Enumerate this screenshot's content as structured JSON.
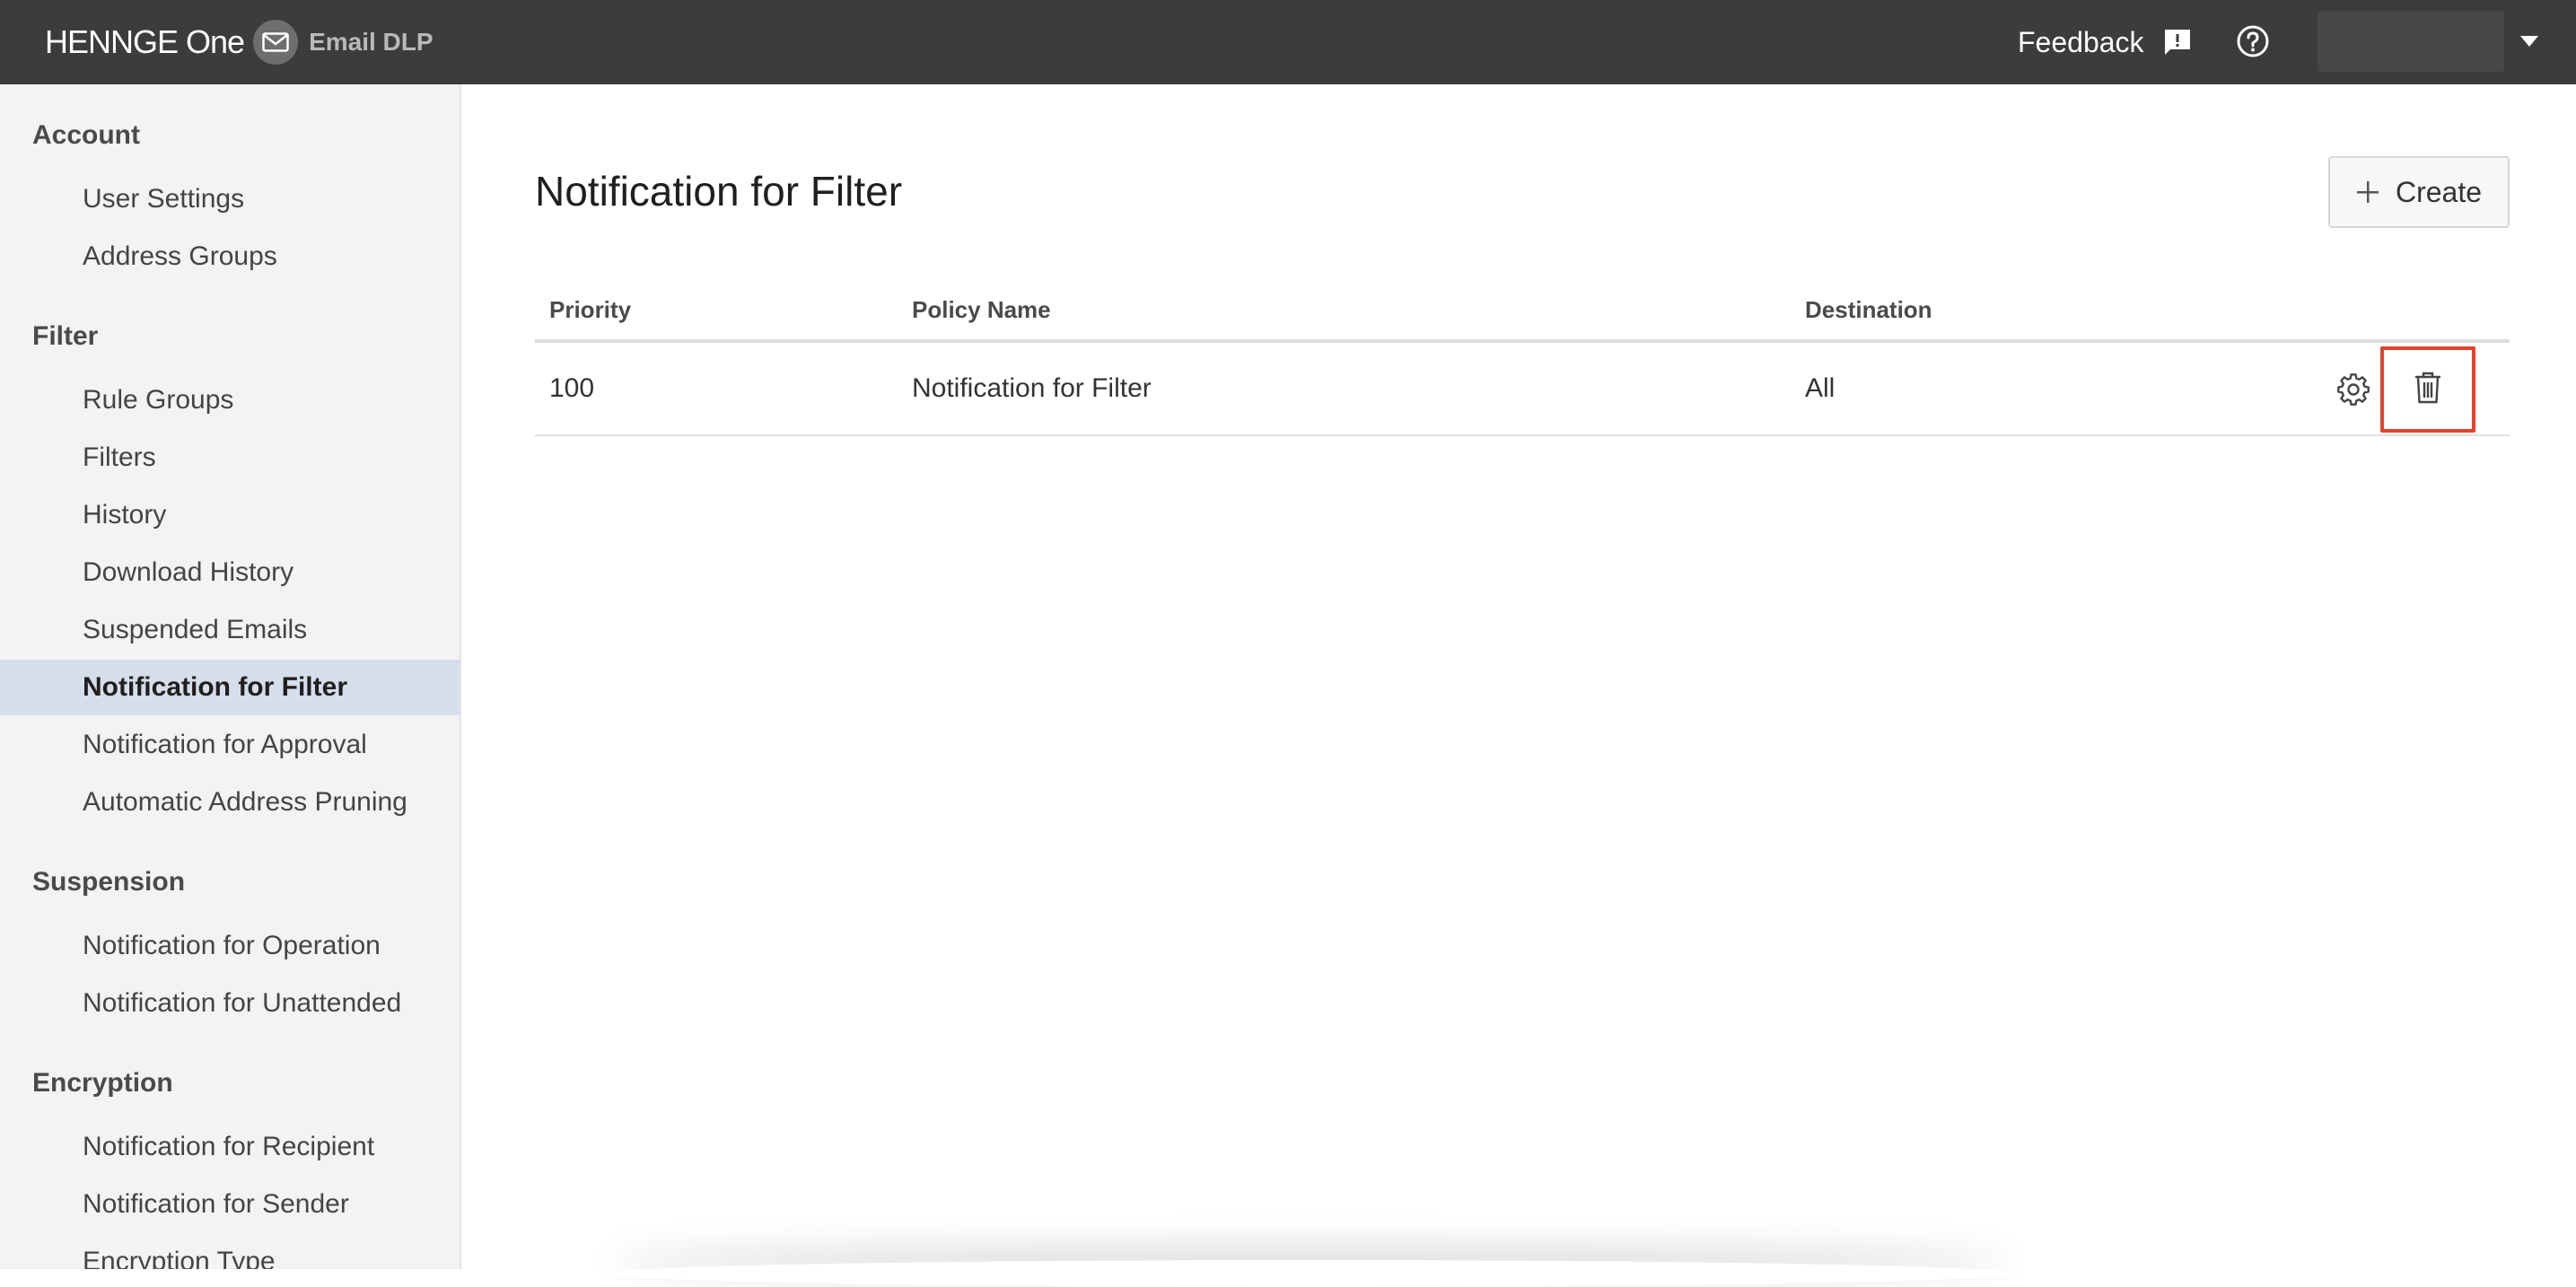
{
  "header": {
    "brand_name": "HENNGE One",
    "product_name": "Email DLP",
    "feedback_label": "Feedback",
    "user_name": ""
  },
  "sidebar": {
    "sections": [
      {
        "title": "Account",
        "items": [
          "User Settings",
          "Address Groups"
        ]
      },
      {
        "title": "Filter",
        "items": [
          "Rule Groups",
          "Filters",
          "History",
          "Download History",
          "Suspended Emails",
          "Notification for Filter",
          "Notification for Approval",
          "Automatic Address Pruning"
        ]
      },
      {
        "title": "Suspension",
        "items": [
          "Notification for Operation",
          "Notification for Unattended"
        ]
      },
      {
        "title": "Encryption",
        "items": [
          "Notification for Recipient",
          "Notification for Sender",
          "Encryption Type"
        ]
      }
    ],
    "active_item": "Notification for Filter"
  },
  "main": {
    "title": "Notification for Filter",
    "create_label": "Create",
    "table": {
      "columns": [
        "Priority",
        "Policy Name",
        "Destination"
      ],
      "rows": [
        {
          "priority": "100",
          "policy_name": "Notification for Filter",
          "destination": "All"
        }
      ]
    }
  },
  "colors": {
    "topbar": "#3c3c3c",
    "sidebar_bg": "#f3f3f3",
    "active_item_bg": "#d6deea",
    "highlight_border": "#e0442e"
  },
  "icons": {
    "brand_logo": "mail-icon",
    "feedback": "feedback-icon",
    "help": "help-circle-icon",
    "user_menu": "chevron-down-icon",
    "create": "plus-icon",
    "row_settings": "gear-icon",
    "row_delete": "trash-icon"
  }
}
